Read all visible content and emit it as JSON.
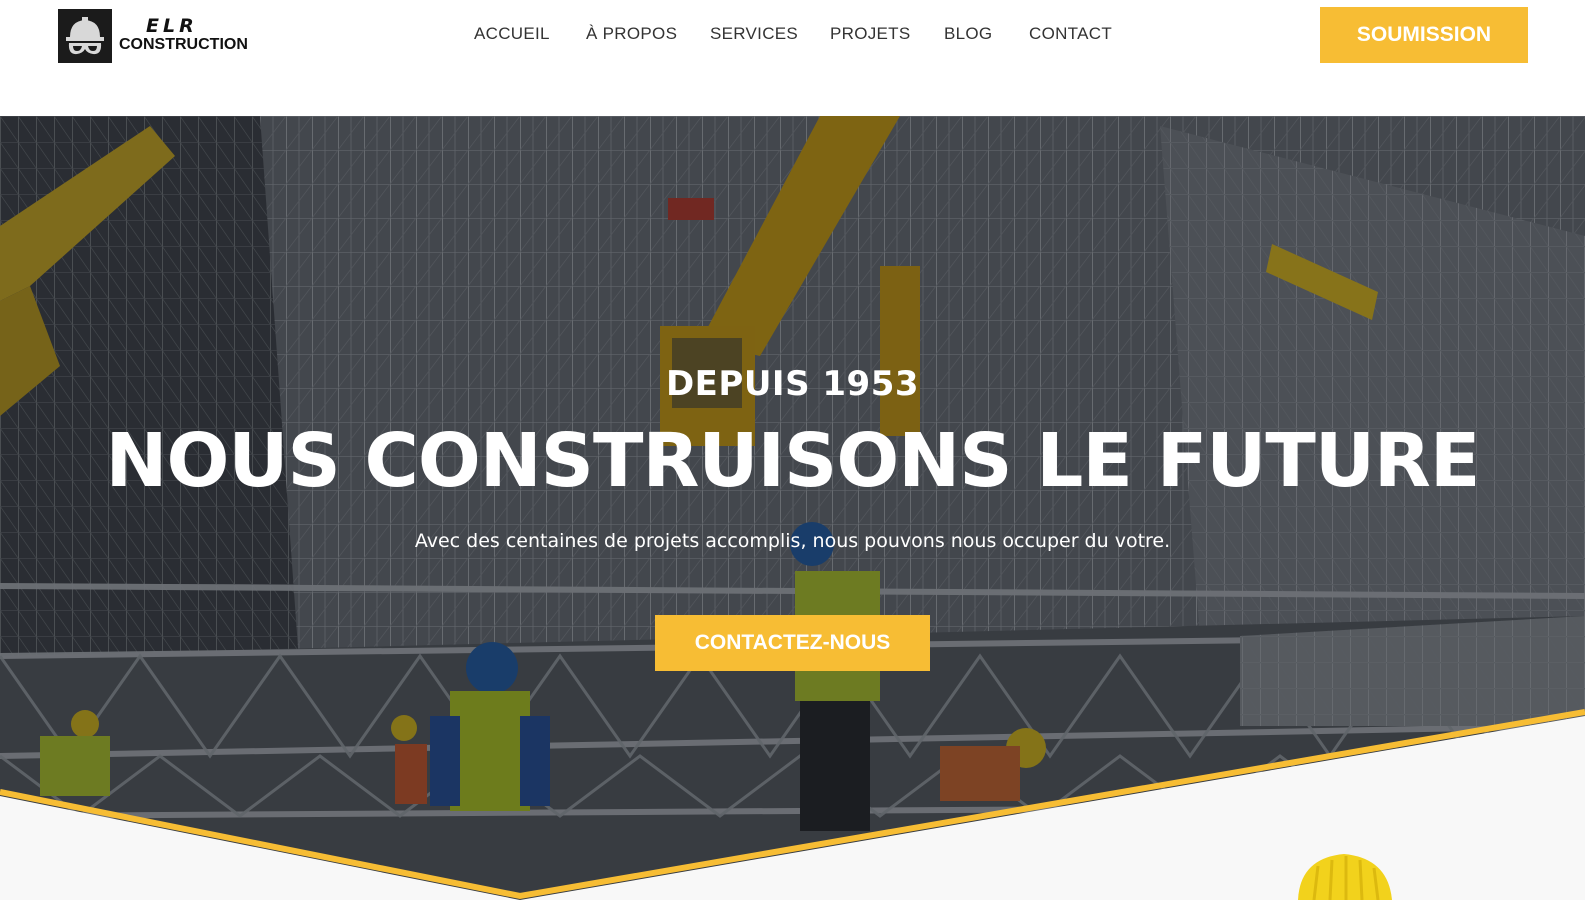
{
  "brand": {
    "name": "ELR",
    "subtitle": "CONSTRUCTION",
    "logo_icon": "hard-hat-goggles-icon"
  },
  "nav": {
    "items": [
      {
        "label": "ACCUEIL"
      },
      {
        "label": "À PROPOS"
      },
      {
        "label": "SERVICES"
      },
      {
        "label": "PROJETS"
      },
      {
        "label": "BLOG"
      },
      {
        "label": "CONTACT"
      }
    ],
    "cta_label": "SOUMISSION"
  },
  "hero": {
    "eyebrow": "DEPUIS 1953",
    "title": "NOUS CONSTRUISONS LE FUTURE",
    "text": "Avec des centaines de projets accomplis, nous pouvons nous occuper du votre.",
    "button_label": "CONTACTEZ-NOUS",
    "background": "construction-site-scaffolding-photo"
  },
  "colors": {
    "accent": "#f7bd34",
    "nav_text": "#333333",
    "hero_text": "#ffffff",
    "wedge": "#f8f8f8"
  }
}
